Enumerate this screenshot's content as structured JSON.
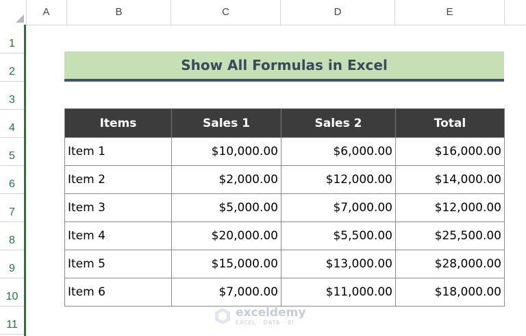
{
  "columns": [
    "A",
    "B",
    "C",
    "D",
    "E"
  ],
  "rows": [
    "1",
    "2",
    "3",
    "4",
    "5",
    "6",
    "7",
    "8",
    "9",
    "10",
    "11"
  ],
  "title": "Show All Formulas in Excel",
  "table": {
    "headers": [
      "Items",
      "Sales 1",
      "Sales 2",
      "Total"
    ],
    "rows": [
      [
        "Item 1",
        "$10,000.00",
        "$6,000.00",
        "$16,000.00"
      ],
      [
        "Item 2",
        "$2,000.00",
        "$12,000.00",
        "$14,000.00"
      ],
      [
        "Item 3",
        "$5,000.00",
        "$7,000.00",
        "$12,000.00"
      ],
      [
        "Item 4",
        "$20,000.00",
        "$5,500.00",
        "$25,500.00"
      ],
      [
        "Item 5",
        "$15,000.00",
        "$13,000.00",
        "$28,000.00"
      ],
      [
        "Item 6",
        "$7,000.00",
        "$11,000.00",
        "$18,000.00"
      ]
    ]
  },
  "watermark": {
    "name": "exceldemy",
    "tagline": "EXCEL · DATA · BI",
    "icon": "exceldemy-logo-icon"
  },
  "colors": {
    "title_fill": "#c6dfb4",
    "title_text": "#3b4a58",
    "title_underline": "#44546a",
    "header_fill": "#3c3c3c",
    "row_header_accent": "#217346"
  }
}
